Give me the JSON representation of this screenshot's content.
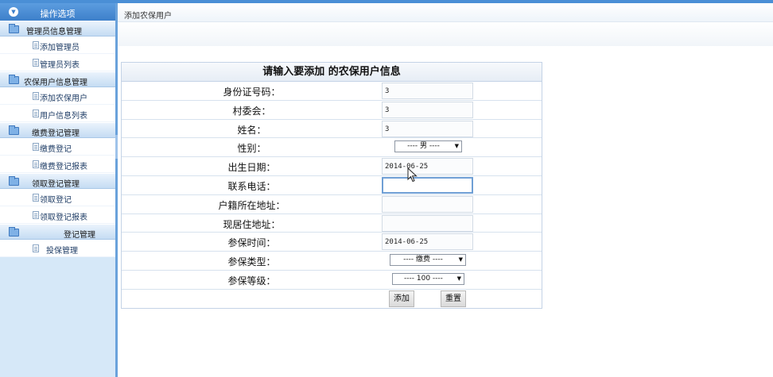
{
  "sidebar": {
    "header": "操作选项",
    "groups": [
      {
        "label": "管理员信息管理",
        "items": [
          "添加管理员",
          "管理员列表"
        ]
      },
      {
        "label": "农保用户信息管理",
        "items": [
          "添加农保用户",
          "用户信息列表"
        ]
      },
      {
        "label": "缴费登记管理",
        "items": [
          "缴费登记",
          "缴费登记报表"
        ]
      },
      {
        "label": "领取登记管理",
        "items": [
          "领取登记",
          "领取登记报表"
        ]
      },
      {
        "label": "登记管理",
        "items": [
          "投保管理"
        ]
      }
    ]
  },
  "breadcrumb": "添加农保用户",
  "form": {
    "title": "请输入要添加 的农保用户信息",
    "fields": {
      "id_number": {
        "label": "身份证号码：",
        "value": "3"
      },
      "village": {
        "label": "村委会：",
        "value": "3"
      },
      "name": {
        "label": "姓名：",
        "value": "3"
      },
      "gender": {
        "label": "性别：",
        "value": "---- 男 ----"
      },
      "birth_date": {
        "label": "出生日期：",
        "value": "2014-06-25"
      },
      "phone": {
        "label": "联系电话：",
        "value": ""
      },
      "hukou_address": {
        "label": "户籍所在地址：",
        "value": ""
      },
      "current_address": {
        "label": "现居住地址：",
        "value": ""
      },
      "insure_time": {
        "label": "参保时间：",
        "value": "2014-06-25"
      },
      "insure_type": {
        "label": "参保类型：",
        "value": "---- 缴费 ----"
      },
      "insure_level": {
        "label": "参保等级：",
        "value": "---- 100 ----"
      }
    },
    "buttons": {
      "add": "添加",
      "reset": "重置"
    }
  },
  "colors": {
    "accent": "#3d7fca",
    "sidebar_bg": "#d6e8f8"
  }
}
